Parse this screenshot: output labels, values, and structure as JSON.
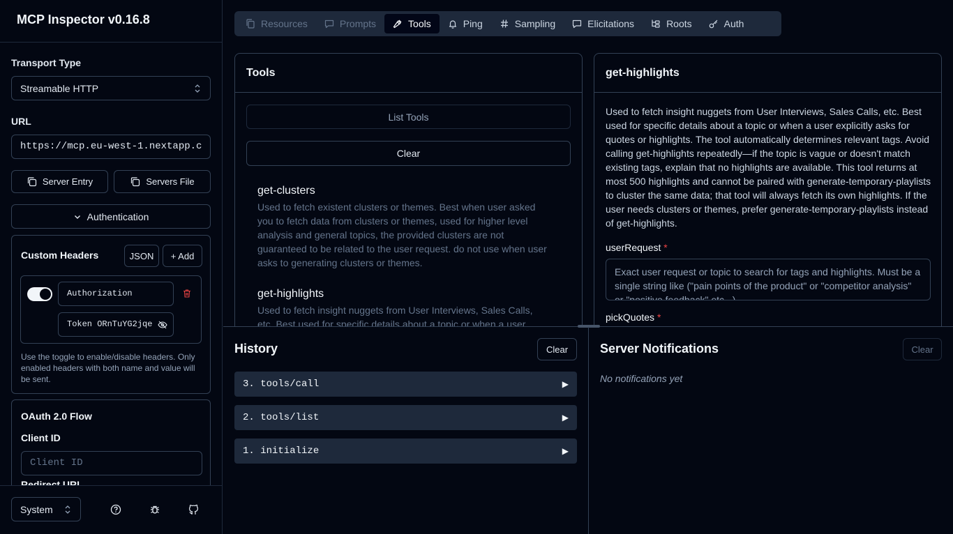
{
  "app": {
    "title": "MCP Inspector v0.16.8"
  },
  "sidebar": {
    "transport_label": "Transport Type",
    "transport_value": "Streamable HTTP",
    "url_label": "URL",
    "url_value": "https://mcp.eu-west-1.nextapp.c",
    "server_entry": "Server Entry",
    "servers_file": "Servers File",
    "authentication": "Authentication",
    "custom_headers": "Custom Headers",
    "json_btn": "JSON",
    "add_btn": "+ Add",
    "header_name": "Authorization",
    "header_value": "Token ORnTuYG2jqe",
    "headers_help": "Use the toggle to enable/disable headers. Only enabled headers with both name and value will be sent.",
    "oauth_title": "OAuth 2.0 Flow",
    "client_id_label": "Client ID",
    "client_id_placeholder": "Client ID",
    "redirect_label": "Redirect URL",
    "theme_value": "System"
  },
  "tabs": [
    {
      "label": "Resources",
      "icon": "files-icon",
      "state": "disabled"
    },
    {
      "label": "Prompts",
      "icon": "message-icon",
      "state": "disabled"
    },
    {
      "label": "Tools",
      "icon": "hammer-icon",
      "state": "active"
    },
    {
      "label": "Ping",
      "icon": "bell-icon",
      "state": "normal"
    },
    {
      "label": "Sampling",
      "icon": "hash-icon",
      "state": "normal"
    },
    {
      "label": "Elicitations",
      "icon": "message-square-icon",
      "state": "normal"
    },
    {
      "label": "Roots",
      "icon": "folder-tree-icon",
      "state": "normal"
    },
    {
      "label": "Auth",
      "icon": "key-icon",
      "state": "normal"
    }
  ],
  "tools_panel": {
    "title": "Tools",
    "list_tools": "List Tools",
    "clear": "Clear",
    "items": [
      {
        "name": "get-clusters",
        "description": "Used to fetch existent clusters or themes. Best when user asked you to fetch data from clusters or themes, used for higher level analysis and general topics, the provided clusters are not guaranteed to be related to the user request. do not use when user asks to generating clusters or themes."
      },
      {
        "name": "get-highlights",
        "description": "Used to fetch insight nuggets from User Interviews, Sales Calls, etc. Best used for specific details about a topic or when a user"
      }
    ]
  },
  "detail_panel": {
    "title": "get-highlights",
    "description": "Used to fetch insight nuggets from User Interviews, Sales Calls, etc. Best used for specific details about a topic or when a user explicitly asks for quotes or highlights. The tool automatically determines relevant tags. Avoid calling get-highlights repeatedly—if the topic is vague or doesn't match existing tags, explain that no highlights are available. This tool returns at most 500 highlights and cannot be paired with generate-temporary-playlists to cluster the same data; that tool will always fetch its own highlights. If the user needs clusters or themes, prefer generate-temporary-playlists instead of get-highlights.",
    "param1_label": "userRequest",
    "param1_placeholder": "Exact user request or topic to search for tags and highlights. Must be a single string like (\"pain points of the product\" or \"competitor analysis\" or \"positive feedback\" etc...)",
    "param2_label": "pickQuotes",
    "required_mark": "*"
  },
  "history": {
    "title": "History",
    "clear": "Clear",
    "items": [
      "3. tools/call",
      "2. tools/list",
      "1. initialize"
    ],
    "expand_glyph": "▶"
  },
  "notifications": {
    "title": "Server Notifications",
    "clear": "Clear",
    "empty": "No notifications yet"
  }
}
